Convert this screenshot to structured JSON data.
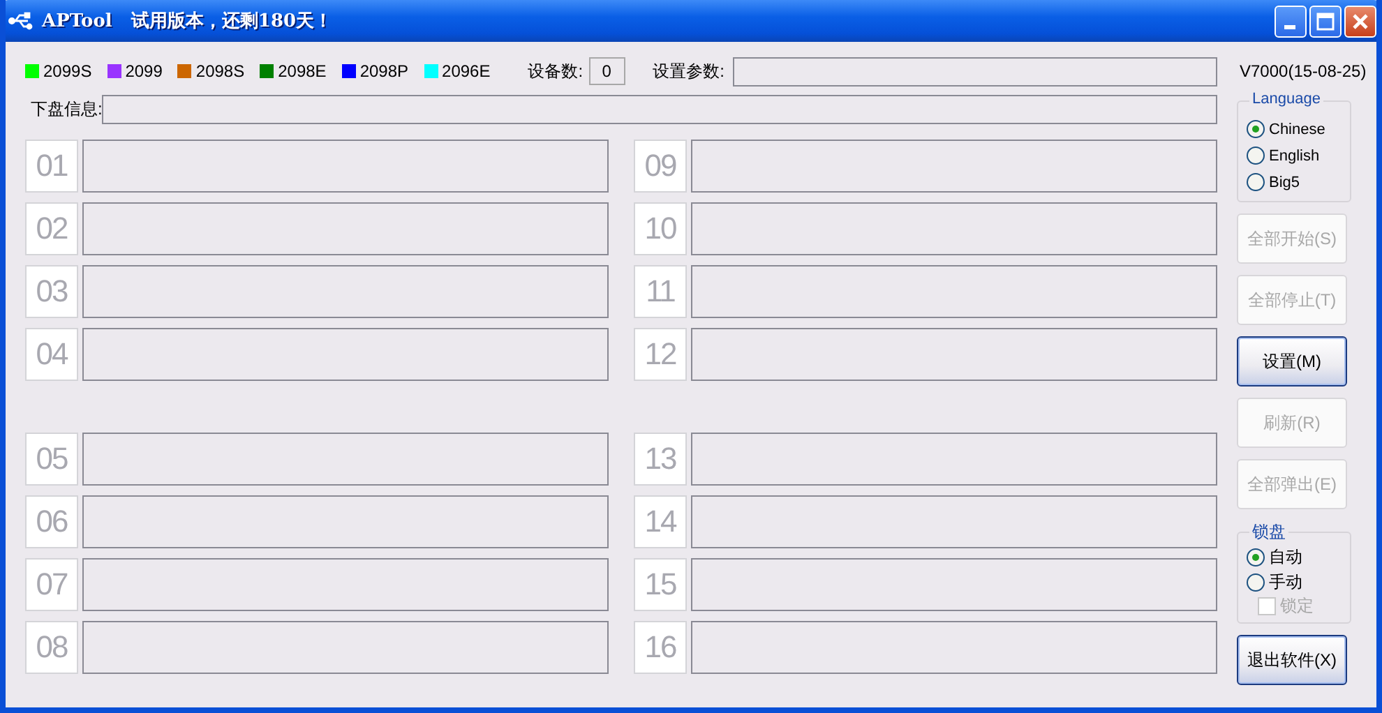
{
  "window": {
    "title": "APTool   试用版本，还剩180天！"
  },
  "legend": [
    {
      "label": "2099S",
      "color": "#00ff00"
    },
    {
      "label": "2099",
      "color": "#9933ff"
    },
    {
      "label": "2098S",
      "color": "#cc6600"
    },
    {
      "label": "2098E",
      "color": "#008000"
    },
    {
      "label": "2098P",
      "color": "#0000ff"
    },
    {
      "label": "2096E",
      "color": "#00ffff"
    }
  ],
  "device_count": {
    "label": "设备数:",
    "value": "0"
  },
  "settings_params": {
    "label": "设置参数:"
  },
  "disk_info": {
    "label": "下盘信息:"
  },
  "slot_columns": [
    {
      "groups": [
        {
          "slots": [
            "01",
            "02",
            "03",
            "04"
          ]
        },
        {
          "slots": [
            "05",
            "06",
            "07",
            "08"
          ]
        }
      ]
    },
    {
      "groups": [
        {
          "slots": [
            "09",
            "10",
            "11",
            "12"
          ]
        },
        {
          "slots": [
            "13",
            "14",
            "15",
            "16"
          ]
        }
      ]
    }
  ],
  "version": "V7000(15-08-25)",
  "language": {
    "title": "Language",
    "options": [
      {
        "label": "Chinese",
        "selected": true
      },
      {
        "label": "English",
        "selected": false
      },
      {
        "label": "Big5",
        "selected": false
      }
    ]
  },
  "buttons": [
    {
      "label": "全部开始(S)",
      "disabled": true
    },
    {
      "label": "全部停止(T)",
      "disabled": true
    },
    {
      "label": "设置(M)",
      "disabled": false
    },
    {
      "label": "刷新(R)",
      "disabled": true
    },
    {
      "label": "全部弹出(E)",
      "disabled": true
    }
  ],
  "lock": {
    "title": "锁盘",
    "options": [
      {
        "label": "自动",
        "selected": true
      },
      {
        "label": "手动",
        "selected": false
      }
    ],
    "checkbox": {
      "label": "锁定",
      "checked": false,
      "disabled": true
    }
  },
  "exit_button": {
    "label": "退出软件(X)",
    "disabled": false
  }
}
